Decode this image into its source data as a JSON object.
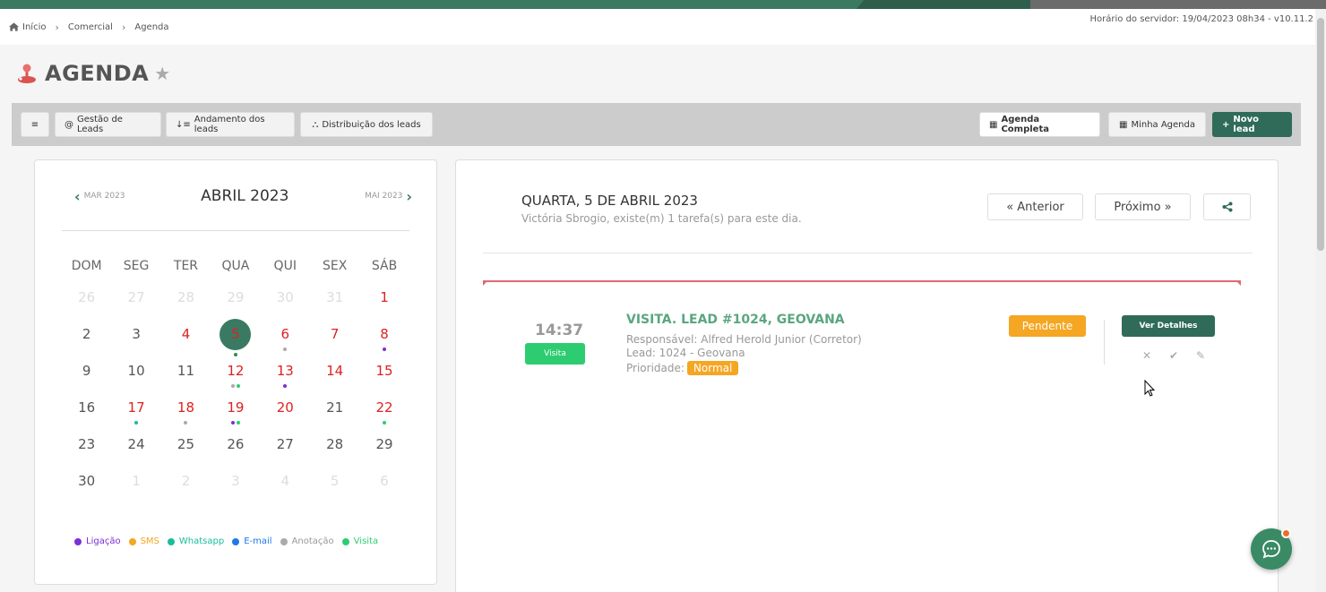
{
  "breadcrumb": {
    "home": "Início",
    "level1": "Comercial",
    "level2": "Agenda"
  },
  "server_time": "Horário do servidor: 19/04/2023 08h34 - v10.11.2",
  "page": {
    "title": "AGENDA"
  },
  "toolbar": {
    "menu_icon": "≡",
    "gestao": "Gestão de Leads",
    "andamento": "Andamento dos leads",
    "distribuicao": "Distribuição dos leads",
    "agenda_completa": "Agenda Completa",
    "minha_agenda": "Minha Agenda",
    "novo_lead": "Novo lead"
  },
  "calendar": {
    "prev_month": "MAR 2023",
    "month": "ABRIL 2023",
    "next_month": "MAI 2023",
    "weekdays": [
      "DOM",
      "SEG",
      "TER",
      "QUA",
      "QUI",
      "SEX",
      "SÁB"
    ],
    "weeks": [
      [
        "26",
        "27",
        "28",
        "29",
        "30",
        "31",
        "1"
      ],
      [
        "2",
        "3",
        "4",
        "5",
        "6",
        "7",
        "8"
      ],
      [
        "9",
        "10",
        "11",
        "12",
        "13",
        "14",
        "15"
      ],
      [
        "16",
        "17",
        "18",
        "19",
        "20",
        "21",
        "22"
      ],
      [
        "23",
        "24",
        "25",
        "26",
        "27",
        "28",
        "29"
      ],
      [
        "30",
        "1",
        "2",
        "3",
        "4",
        "5",
        "6"
      ]
    ],
    "legend": [
      {
        "label": "Ligação",
        "color": "#7b2fd6"
      },
      {
        "label": "SMS",
        "color": "#f5a623"
      },
      {
        "label": "Whatsapp",
        "color": "#1abc9c"
      },
      {
        "label": "E-mail",
        "color": "#1e7ae6"
      },
      {
        "label": "Anotação",
        "color": "#aaaaaa"
      },
      {
        "label": "Visita",
        "color": "#2ecc71"
      }
    ]
  },
  "day": {
    "title": "QUARTA, 5 DE ABRIL 2023",
    "subtitle": "Victória Sbrogio, existe(m) 1 tarefa(s) para este dia.",
    "prev": "« Anterior",
    "next": "Próximo »"
  },
  "task": {
    "time": "14:37",
    "type": "Visita",
    "title": "VISITA. LEAD #1024, GEOVANA",
    "responsavel": "Responsável: Alfred Herold Junior (Corretor)",
    "lead": "Lead: 1024 - Geovana",
    "prioridade_label": "Prioridade:",
    "prioridade": "Normal",
    "status": "Pendente",
    "details": "Ver Detalhes"
  }
}
